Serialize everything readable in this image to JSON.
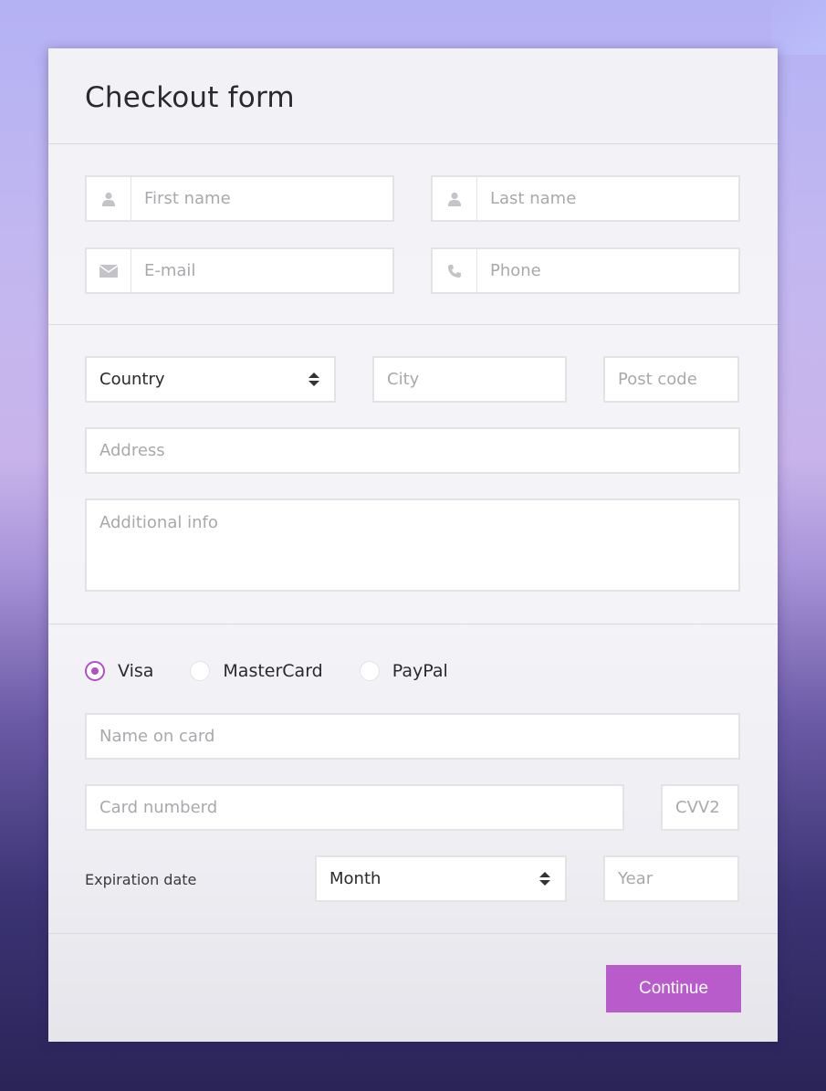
{
  "form": {
    "title": "Checkout form",
    "personal": {
      "first_name": {
        "placeholder": "First name",
        "icon": "user-icon"
      },
      "last_name": {
        "placeholder": "Last name",
        "icon": "user-icon"
      },
      "email": {
        "placeholder": "E-mail",
        "icon": "envelope-icon"
      },
      "phone": {
        "placeholder": "Phone",
        "icon": "phone-icon"
      }
    },
    "address": {
      "country": {
        "value": "Country"
      },
      "city": {
        "placeholder": "City"
      },
      "post_code": {
        "placeholder": "Post code"
      },
      "address": {
        "placeholder": "Address"
      },
      "additional_info": {
        "placeholder": "Additional info"
      }
    },
    "payment": {
      "methods": [
        {
          "label": "Visa",
          "checked": true
        },
        {
          "label": "MasterCard",
          "checked": false
        },
        {
          "label": "PayPal",
          "checked": false
        }
      ],
      "name_on_card": {
        "placeholder": "Name on card"
      },
      "card_number": {
        "placeholder": "Card numberd"
      },
      "cvv": {
        "placeholder": "CVV2"
      },
      "expiration_label": "Expiration date",
      "month": {
        "value": "Month"
      },
      "year": {
        "placeholder": "Year"
      }
    },
    "continue_label": "Continue"
  },
  "colors": {
    "accent": "#b85bcb",
    "radio_checked": "#b24fc4",
    "field_border": "#e3e3e6",
    "placeholder": "#a9a9ad"
  }
}
